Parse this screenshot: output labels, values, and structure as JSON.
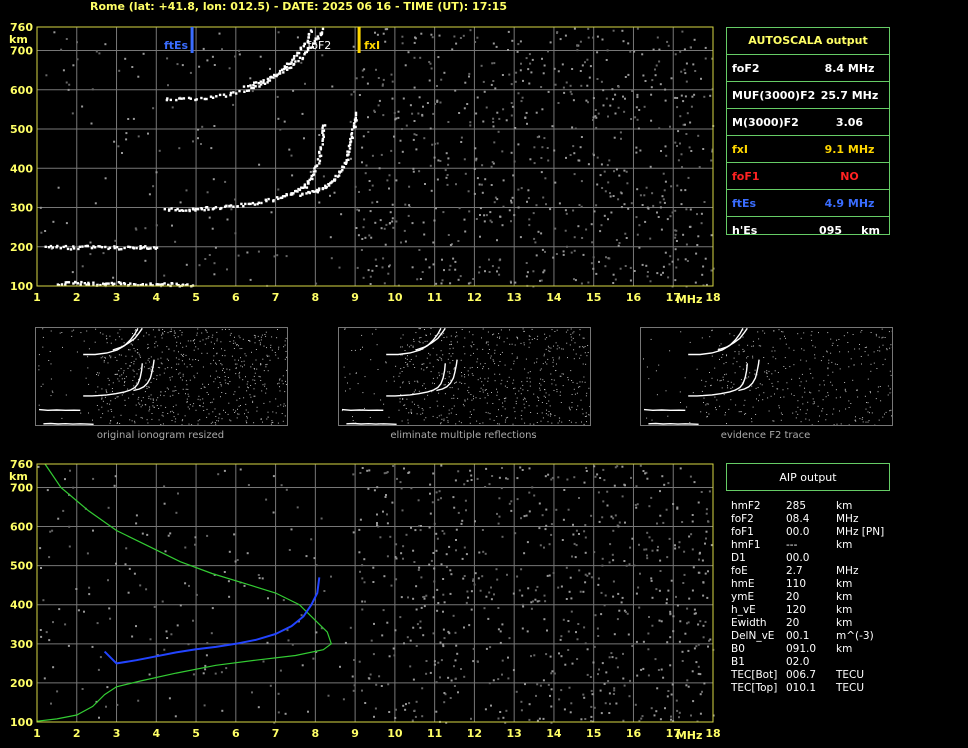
{
  "header": "Rome (lat: +41.8, lon: 012.5) - DATE: 2025 06 16 - TIME (UT): 17:15",
  "colors": {
    "axis": "#ffff66",
    "grid": "#777777",
    "frame": "#d8d844",
    "fxi": "#ffd700",
    "ftes": "#3a6dff",
    "profile": "#33cc33",
    "trace": "#2244ff",
    "foF1": "#ff2222",
    "box": "#66cc66"
  },
  "chart_data": [
    {
      "type": "scatter",
      "name_label": "main_ionogram",
      "xlim": [
        1,
        18
      ],
      "ylim": [
        100,
        760
      ],
      "x_ticks": [
        "1",
        "2",
        "3",
        "4",
        "5",
        "6",
        "7",
        "8",
        "9",
        "10",
        "11",
        "12",
        "13",
        "14",
        "15",
        "16",
        "17",
        "18"
      ],
      "y_ticks": [
        "100",
        "200",
        "300",
        "400",
        "500",
        "600",
        "700",
        "760"
      ],
      "x_unit": "MHz",
      "y_unit": "km",
      "markers": [
        {
          "label": "ftEs",
          "x": 4.9,
          "color": "#3a6dff"
        },
        {
          "label": "fxI",
          "x": 9.1,
          "color": "#ffd700"
        },
        {
          "label": "foF2",
          "x": 8.1,
          "color": "#ffffff"
        }
      ],
      "traces": [
        {
          "name": "Es",
          "points": [
            [
              1.5,
              108
            ],
            [
              2.0,
              110
            ],
            [
              2.5,
              107
            ],
            [
              3.0,
              109
            ],
            [
              3.5,
              106
            ],
            [
              4.0,
              108
            ],
            [
              4.5,
              106
            ],
            [
              4.9,
              105
            ]
          ]
        },
        {
          "name": "E2",
          "points": [
            [
              1.2,
              205
            ],
            [
              1.8,
              200
            ],
            [
              2.4,
              202
            ],
            [
              3.0,
              200
            ],
            [
              3.6,
              201
            ],
            [
              4.0,
              200
            ]
          ]
        },
        {
          "name": "F2o",
          "points": [
            [
              4.2,
              298
            ],
            [
              4.8,
              298
            ],
            [
              5.2,
              300
            ],
            [
              5.8,
              305
            ],
            [
              6.4,
              313
            ],
            [
              7.0,
              325
            ],
            [
              7.4,
              338
            ],
            [
              7.7,
              355
            ],
            [
              7.9,
              380
            ],
            [
              8.05,
              420
            ],
            [
              8.15,
              470
            ],
            [
              8.2,
              520
            ]
          ]
        },
        {
          "name": "F2x",
          "points": [
            [
              7.6,
              335
            ],
            [
              8.0,
              345
            ],
            [
              8.3,
              360
            ],
            [
              8.55,
              385
            ],
            [
              8.75,
              420
            ],
            [
              8.85,
              460
            ],
            [
              8.95,
              510
            ],
            [
              9.0,
              545
            ]
          ]
        },
        {
          "name": "F2o2",
          "points": [
            [
              4.2,
              580
            ],
            [
              5.0,
              580
            ],
            [
              5.8,
              590
            ],
            [
              6.5,
              610
            ],
            [
              7.0,
              640
            ],
            [
              7.4,
              680
            ],
            [
              7.7,
              720
            ],
            [
              7.9,
              758
            ]
          ]
        },
        {
          "name": "F2x2",
          "points": [
            [
              6.2,
              610
            ],
            [
              6.8,
              630
            ],
            [
              7.3,
              660
            ],
            [
              7.7,
              690
            ],
            [
              8.0,
              730
            ],
            [
              8.2,
              758
            ]
          ]
        }
      ]
    },
    {
      "type": "scatter",
      "name_label": "aip_ionogram",
      "xlim": [
        1,
        18
      ],
      "ylim": [
        100,
        760
      ],
      "x_ticks": [
        "1",
        "2",
        "3",
        "4",
        "5",
        "6",
        "7",
        "8",
        "9",
        "10",
        "11",
        "12",
        "13",
        "14",
        "15",
        "16",
        "17",
        "18"
      ],
      "y_ticks": [
        "100",
        "200",
        "300",
        "400",
        "500",
        "600",
        "700",
        "760"
      ],
      "x_unit": "MHz",
      "y_unit": "km",
      "profile": [
        [
          1.2,
          760
        ],
        [
          1.6,
          700
        ],
        [
          2.3,
          640
        ],
        [
          3.0,
          590
        ],
        [
          3.8,
          550
        ],
        [
          4.6,
          510
        ],
        [
          5.4,
          480
        ],
        [
          6.2,
          455
        ],
        [
          7.0,
          430
        ],
        [
          7.6,
          400
        ],
        [
          8.0,
          360
        ],
        [
          8.3,
          330
        ],
        [
          8.4,
          300
        ],
        [
          8.2,
          285
        ],
        [
          7.5,
          270
        ],
        [
          6.5,
          258
        ],
        [
          5.5,
          245
        ],
        [
          4.5,
          225
        ],
        [
          3.6,
          205
        ],
        [
          3.0,
          190
        ],
        [
          2.7,
          170
        ],
        [
          2.4,
          140
        ],
        [
          2.0,
          118
        ],
        [
          1.5,
          108
        ],
        [
          1.0,
          102
        ]
      ],
      "fit_trace": [
        [
          2.7,
          280
        ],
        [
          3.0,
          250
        ],
        [
          3.5,
          258
        ],
        [
          4.0,
          268
        ],
        [
          4.5,
          278
        ],
        [
          5.0,
          286
        ],
        [
          5.5,
          292
        ],
        [
          6.0,
          300
        ],
        [
          6.5,
          310
        ],
        [
          7.0,
          325
        ],
        [
          7.4,
          345
        ],
        [
          7.7,
          370
        ],
        [
          7.9,
          400
        ],
        [
          8.05,
          430
        ],
        [
          8.1,
          470
        ]
      ]
    }
  ],
  "thumbnails": [
    {
      "caption": "original ionogram resized"
    },
    {
      "caption": "eliminate multiple reflections"
    },
    {
      "caption": "evidence F2 trace"
    }
  ],
  "autoscala": {
    "title": "AUTOSCALA output",
    "rows": [
      {
        "key": "foF2",
        "value": "8.4 MHz",
        "color": "#ffffff"
      },
      {
        "key": "MUF(3000)F2",
        "value": "25.7 MHz",
        "color": "#ffffff"
      },
      {
        "key": "M(3000)F2",
        "value": "3.06",
        "color": "#ffffff"
      },
      {
        "key": "fxI",
        "value": "9.1 MHz",
        "color": "#ffd700"
      },
      {
        "key": "foF1",
        "value": "NO",
        "color": "#ff2222"
      },
      {
        "key": "ftEs",
        "value": "4.9 MHz",
        "color": "#3a6dff"
      },
      {
        "key": "h'Es",
        "value": "095     km",
        "color": "#ffffff"
      }
    ]
  },
  "aip": {
    "title": "AIP output",
    "rows": [
      [
        "hmF2",
        "285",
        "km"
      ],
      [
        "foF2",
        "08.4",
        "MHz"
      ],
      [
        "foF1",
        "00.0",
        "MHz   [PN]"
      ],
      [
        "hmF1",
        "---",
        "km"
      ],
      [
        "D1",
        "00.0",
        ""
      ],
      [
        "foE",
        "2.7",
        "MHz"
      ],
      [
        "hmE",
        "110",
        "km"
      ],
      [
        "ymE",
        "20",
        "km"
      ],
      [
        "h_vE",
        "120",
        "km"
      ],
      [
        "Ewidth",
        "20",
        "km"
      ],
      [
        "DelN_vE",
        "00.1",
        "m^(-3)"
      ],
      [
        "B0",
        "091.0",
        "km"
      ],
      [
        "B1",
        "02.0",
        ""
      ],
      [
        "TEC[Bot]",
        "006.7",
        "TECU"
      ],
      [
        "TEC[Top]",
        "010.1",
        "TECU"
      ]
    ]
  }
}
